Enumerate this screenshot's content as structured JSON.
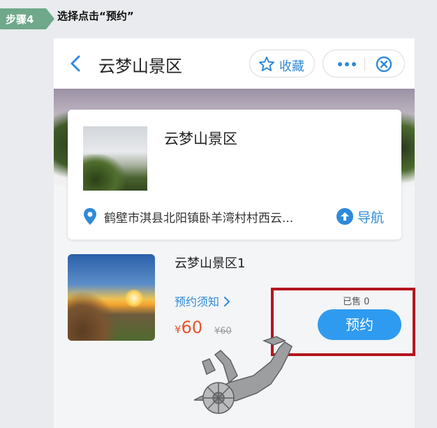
{
  "step": {
    "badge": "步骤4",
    "instruction": "选择点击“预约”"
  },
  "app": {
    "title": "云梦山景区",
    "favorite_label": "收藏",
    "icons": [
      "back-arrow-icon",
      "star-icon",
      "more-icon",
      "close-circle-icon",
      "location-pin-icon",
      "navigation-arrow-icon"
    ]
  },
  "scenic_card": {
    "name": "云梦山景区",
    "address": "鹤壁市淇县北阳镇卧羊湾村村西云...",
    "navigate_label": "导航"
  },
  "product": {
    "name": "云梦山景区1",
    "notice_label": "预约须知",
    "currency": "¥",
    "price": "60",
    "original_price": "¥60",
    "sold": "已售 0",
    "book_label": "预约"
  },
  "colors": {
    "accent": "#2f8ad8",
    "button": "#2f9bf0",
    "price": "#e8542b",
    "highlight": "#b5161e",
    "step_badge": "#6fa88a"
  }
}
